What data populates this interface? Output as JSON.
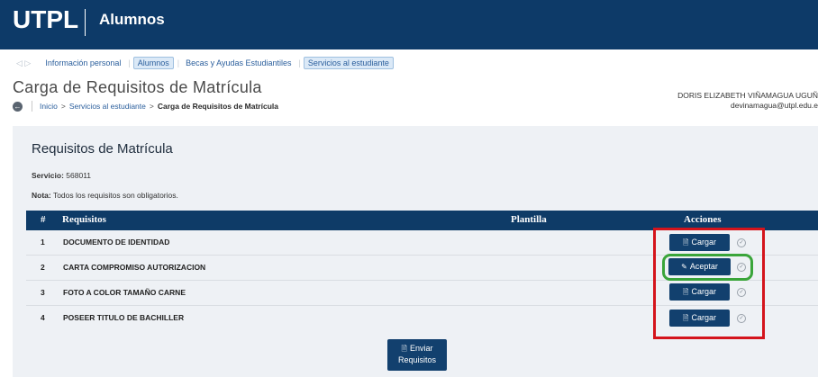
{
  "header": {
    "brand": "UTPL",
    "subtitle": "Alumnos",
    "bg_color": "#0d3a68"
  },
  "nav": {
    "items": [
      {
        "label": "Información personal",
        "boxed": false
      },
      {
        "label": "Alumnos",
        "boxed": true
      },
      {
        "label": "Becas y Ayudas Estudiantiles",
        "boxed": false
      },
      {
        "label": "Servicios al estudiante",
        "boxed": true
      }
    ]
  },
  "page": {
    "title": "Carga de Requisitos de Matrícula",
    "breadcrumb": [
      "Inicio",
      "Servicios al estudiante",
      "Carga de Requisitos de Matrícula"
    ]
  },
  "user": {
    "name": "DORIS ELIZABETH VIÑAMAGUA UGUÑ",
    "email": "devinamagua@utpl.edu.e"
  },
  "section": {
    "heading": "Requisitos de Matrícula",
    "service_label": "Servicio:",
    "service_value": "568011",
    "note_label": "Nota:",
    "note_value": "Todos los requisitos son obligatorios."
  },
  "table": {
    "headers": {
      "num": "#",
      "requisitos": "Requisitos",
      "plantilla": "Plantilla",
      "acciones": "Acciones"
    },
    "rows": [
      {
        "num": "1",
        "name": "DOCUMENTO DE IDENTIDAD",
        "action": "Cargar",
        "icon": "file-upload-icon"
      },
      {
        "num": "2",
        "name": "CARTA COMPROMISO AUTORIZACION",
        "action": "Aceptar",
        "icon": "edit-document-icon"
      },
      {
        "num": "3",
        "name": "FOTO A COLOR TAMAÑO CARNE",
        "action": "Cargar",
        "icon": "file-upload-icon"
      },
      {
        "num": "4",
        "name": "POSEER TITULO DE BACHILLER",
        "action": "Cargar",
        "icon": "file-upload-icon"
      }
    ]
  },
  "send": {
    "line1": "Enviar",
    "line2": "Requisitos"
  },
  "colors": {
    "primary": "#12406e",
    "highlight_red": "#d4141c",
    "highlight_green": "#3aa53a"
  }
}
